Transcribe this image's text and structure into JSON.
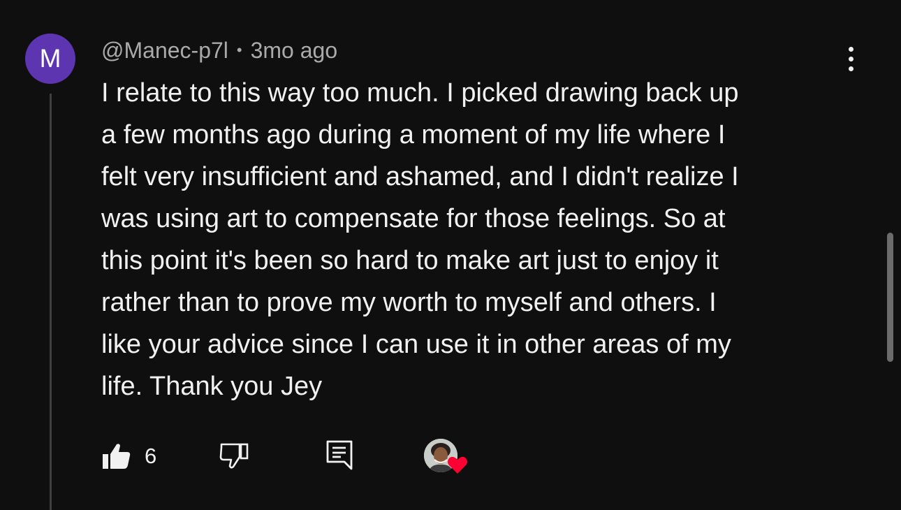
{
  "comment": {
    "avatar_letter": "M",
    "author": "@Manec-p7l",
    "separator": "•",
    "timestamp": "3mo ago",
    "text": "I relate to this way too much. I picked drawing back up\na few months ago during a moment of my life where I\nfelt very insufficient and ashamed, and I didn't realize I\nwas using art to compensate for those feelings. So at\nthis point it's been so hard to make art just to enjoy it\nrather than to prove my worth to myself and others. I\nlike your advice since I can use it in other areas of my\nlife. Thank you Jey"
  },
  "actions": {
    "like_count": "6"
  },
  "icons": {
    "avatar": "letter-avatar",
    "menu": "more-vert-icon",
    "like": "thumbs-up-filled-icon",
    "dislike": "thumbs-down-outline-icon",
    "reply": "reply-comment-icon",
    "creator_heart": "creator-heart-icon"
  },
  "colors": {
    "background": "#0f0f0f",
    "avatar_bg": "#5e35b1",
    "text_primary": "#f1f1f1",
    "text_secondary": "#aaaaaa",
    "heart": "#ff0033"
  }
}
